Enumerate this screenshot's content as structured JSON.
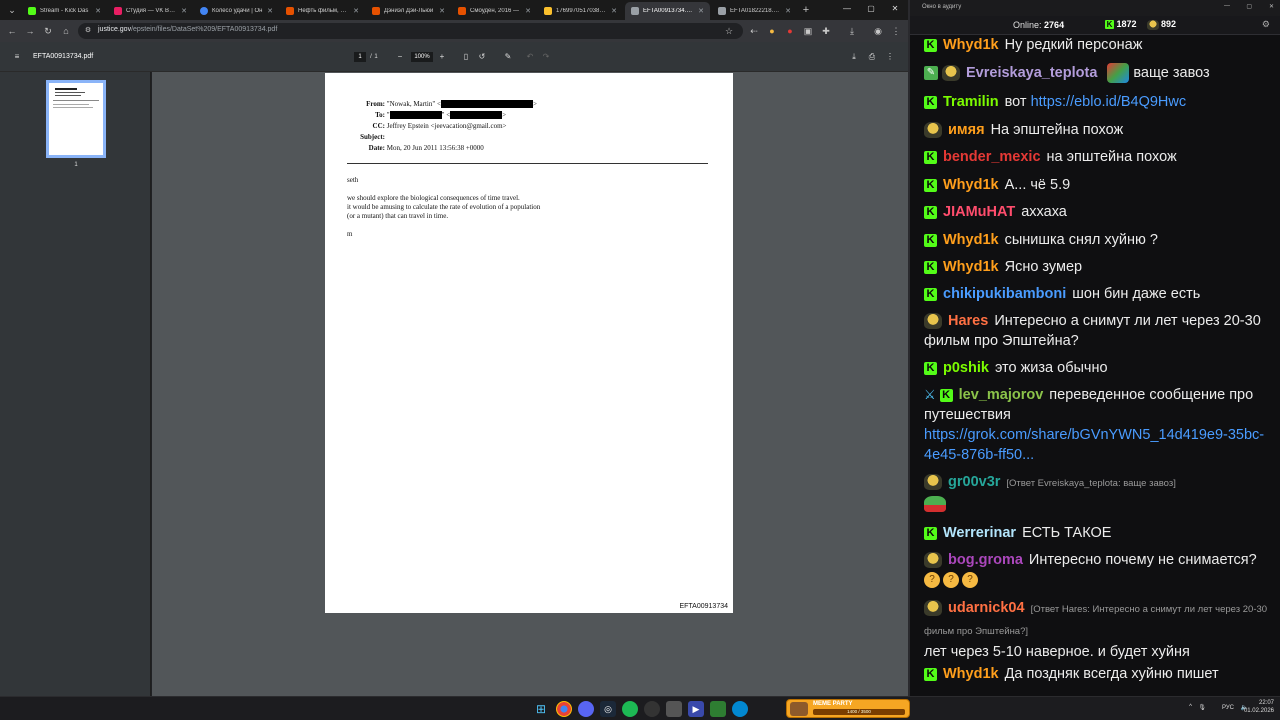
{
  "browser": {
    "tabs": [
      {
        "title": "Stream - Kick Das",
        "color": "#53fc18"
      },
      {
        "title": "Студия — VK Виде",
        "color": "#e91e63"
      },
      {
        "title": "Колесо удачи | Он",
        "color": "#4285f4"
      },
      {
        "title": "Нефть фильм, 200",
        "color": "#e65100"
      },
      {
        "title": "Дэниэл Дэй-Льюи",
        "color": "#e65100"
      },
      {
        "title": "Смоуден, 2016 —",
        "color": "#e65100"
      },
      {
        "title": "17699705170380...",
        "color": "#fbc02d"
      },
      {
        "title": "EFTA00913734.pdf",
        "color": "#9aa0a6"
      },
      {
        "title": "EFTA01822218.pdf",
        "color": "#9aa0a6"
      }
    ],
    "active_tab_index": 7,
    "new_tab_label": "+",
    "url_host": "justice.gov",
    "url_path": "/epstein/files/DataSet%209/EFTA00913734.pdf"
  },
  "pdf": {
    "file_name": "EFTA00913734.pdf",
    "page_current": "1",
    "page_sep": "/",
    "page_total": "1",
    "zoom": "100%",
    "thumb_label": "1",
    "header": {
      "from_label": "From:",
      "from_value": "\"Nowak, Martin\" <",
      "from_tail": ">",
      "to_label": "To:",
      "to_value": "\"",
      "to_mid": "\" <",
      "to_tail": ">",
      "cc_label": "CC:",
      "cc_value": "Jeffrey Epstein <jeevacation@gmail.com>",
      "subject_label": "Subject:",
      "subject_value": "",
      "date_label": "Date:",
      "date_value": "Mon, 20 Jun 2011 13:56:38 +0000"
    },
    "body": {
      "greeting": "seth",
      "line1": "we should explore the biological consequences of time travel.",
      "line2": "it would be amusing to calculate the rate of evolution of a population",
      "line3": "(or a mutant) that can travel in time.",
      "sign": "m"
    },
    "footer_id": "EFTA00913734"
  },
  "chat": {
    "window_title": "Окно в аудиту",
    "online_label": "Online:",
    "online_count": "2764",
    "kick_count": "1872",
    "other_count": "892",
    "messages": [
      {
        "user": "Whyd1k",
        "color": "#ff9f1c",
        "text": "Ну редкий персонаж"
      },
      {
        "user": "Evreiskaya_teplota",
        "color": "#b39ddb",
        "text": "ваще завоз"
      },
      {
        "user": "Tramilin",
        "color": "#7cfc00",
        "text": "вот",
        "link": "https://eblo.id/B4Q9Hwc"
      },
      {
        "user": "имяя",
        "color": "#ff9f1c",
        "text": "На эпштейна похож"
      },
      {
        "user": "bender_mexic",
        "color": "#e53935",
        "text": "на эпштейна похож"
      },
      {
        "user": "Whyd1k",
        "color": "#ff9f1c",
        "text": "А... чё 5.9"
      },
      {
        "user": "JIAMuHAT",
        "color": "#ff4d6d",
        "text": "аххаха"
      },
      {
        "user": "Whyd1k",
        "color": "#ff9f1c",
        "text": "сынишка снял хуйню ?"
      },
      {
        "user": "Whyd1k",
        "color": "#ff9f1c",
        "text": "Ясно зумер"
      },
      {
        "user": "chikipukibamboni",
        "color": "#4a9cff",
        "text": "шон бин даже есть"
      },
      {
        "user": "Hares",
        "color": "#ff7043",
        "text": "Интересно а снимут ли лет через 20-30 фильм про Эпштейна?"
      },
      {
        "user": "p0shik",
        "color": "#7cfc00",
        "text": "это жиза обычно"
      },
      {
        "user": "lev_majorov",
        "color": "#8bc34a",
        "text": "переведенное сообщение про путешествия",
        "link": "https://grok.com/share/bGVnYWN5_14d419e9-35bc-4e45-876b-ff50..."
      },
      {
        "user": "gr00v3r",
        "color": "#26a69a",
        "reply": "[Ответ Evreiskaya_teplota: ваще завоз]"
      },
      {
        "user": "Werrerinar",
        "color": "#b3e5fc",
        "text": "ЕСТЬ ТАКОЕ"
      },
      {
        "user": "bog.groma",
        "color": "#ab47bc",
        "text": "Интересно почему не снимается?"
      },
      {
        "user": "udarnick04",
        "color": "#ff7043",
        "reply": "[Ответ Hares: Интересно а снимут ли лет через 20-30 фильм про Эпштейна?]",
        "text": "лет через 5-10 наверное. и будет хуйня"
      },
      {
        "user": "Whyd1k",
        "color": "#ff9f1c",
        "text": "Да поздняк всегда хуйню пишет"
      }
    ]
  },
  "taskbar": {
    "meme_title": "MEME PARTY",
    "meme_progress": "1400 / 3500",
    "lang": "РУС",
    "time": "22:07",
    "date": "01.02.2026"
  }
}
